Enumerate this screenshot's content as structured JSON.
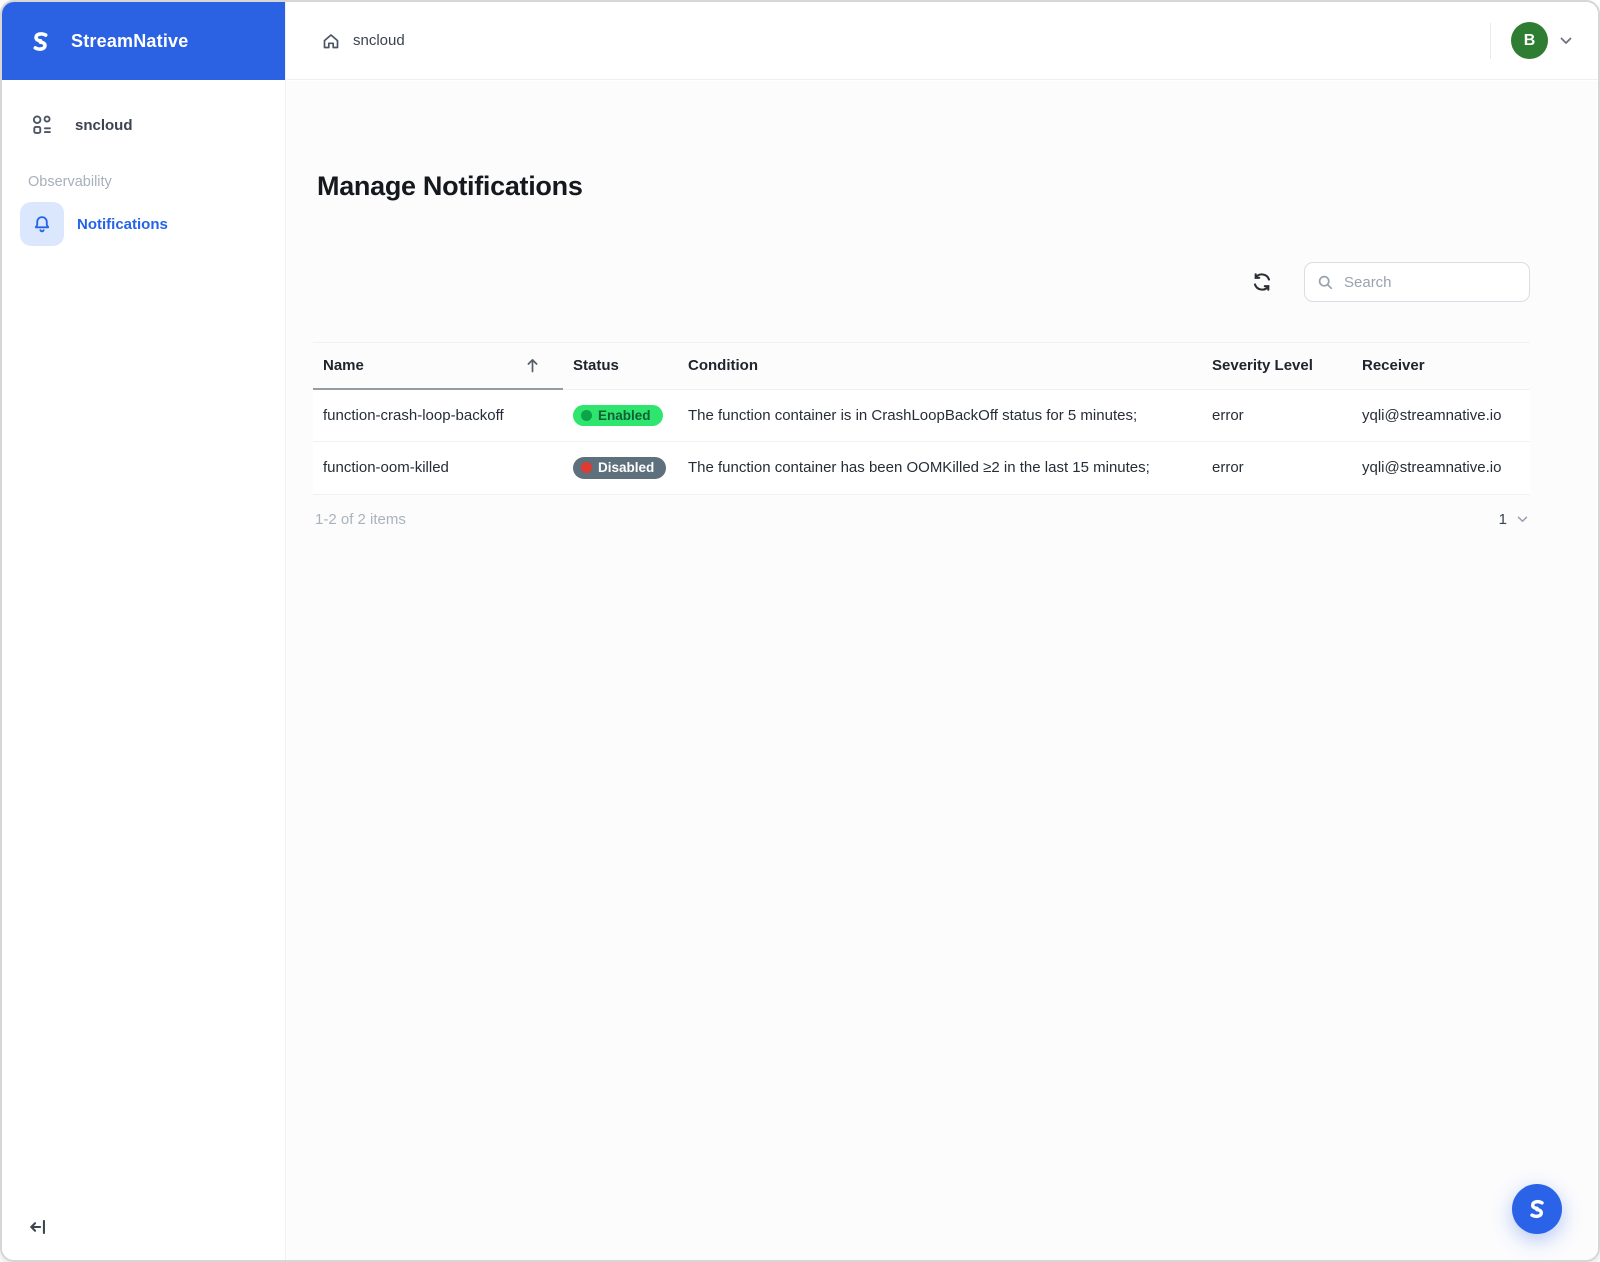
{
  "app": {
    "brand": "StreamNative"
  },
  "sidebar": {
    "sncloud_label": "sncloud",
    "section_label": "Observability",
    "notifications_label": "Notifications"
  },
  "topbar": {
    "breadcrumb": "sncloud",
    "avatar_initial": "B"
  },
  "page": {
    "title": "Manage Notifications"
  },
  "toolbar": {
    "search_placeholder": "Search"
  },
  "table": {
    "columns": [
      "Name",
      "Status",
      "Condition",
      "Severity Level",
      "Receiver"
    ],
    "rows": [
      {
        "name": "function-crash-loop-backoff",
        "status": "Enabled",
        "condition": "The function container is in CrashLoopBackOff status for 5 minutes;",
        "severity": "error",
        "receiver": "yqli@streamnative.io"
      },
      {
        "name": "function-oom-killed",
        "status": "Disabled",
        "condition": "The function container has been OOMKilled ≥2 in the last 15 minutes;",
        "severity": "error",
        "receiver": "yqli@streamnative.io"
      }
    ]
  },
  "pagination": {
    "summary": "1-2 of 2 items",
    "current_page": "1"
  },
  "colors": {
    "brand_blue": "#2B61E3",
    "active_link": "#2563EB",
    "enabled_badge_bg": "#2EE56E",
    "enabled_dot": "#0CA34A",
    "disabled_badge_bg": "#5D707C",
    "disabled_dot": "#E03A31",
    "avatar_green": "#2E7D32"
  }
}
